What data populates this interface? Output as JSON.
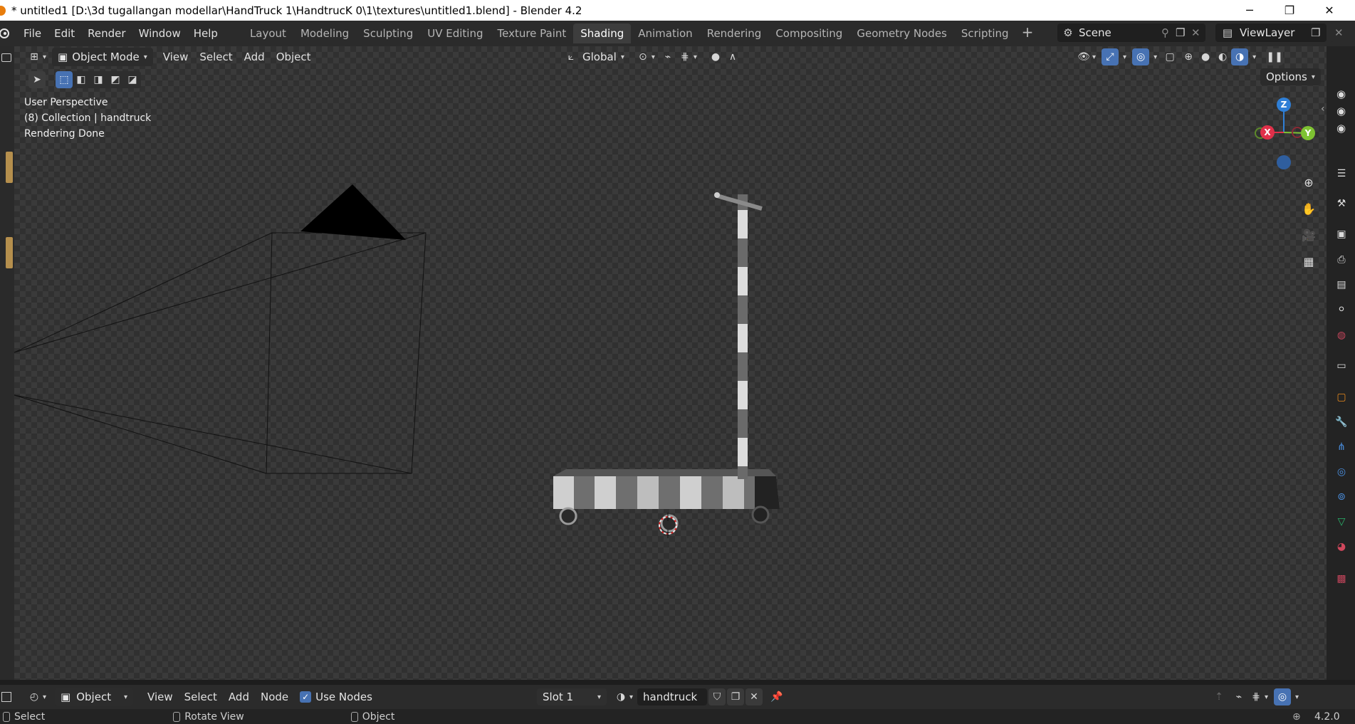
{
  "window": {
    "title": "* untitled1 [D:\\3d tugallangan modellar\\HandTruck 1\\HandtrucK 0\\1\\textures\\untitled1.blend] - Blender 4.2",
    "minimize": "─",
    "maximize": "❐",
    "close": "✕"
  },
  "menu": [
    "File",
    "Edit",
    "Render",
    "Window",
    "Help"
  ],
  "workspaces": [
    "Layout",
    "Modeling",
    "Sculpting",
    "UV Editing",
    "Texture Paint",
    "Shading",
    "Animation",
    "Rendering",
    "Compositing",
    "Geometry Nodes",
    "Scripting"
  ],
  "active_workspace": "Shading",
  "scene": {
    "label": "Scene",
    "view_layer": "ViewLayer"
  },
  "viewport_header": {
    "mode": "Object Mode",
    "menus": [
      "View",
      "Select",
      "Add",
      "Object"
    ],
    "transform_orientation": "Global",
    "options": "Options"
  },
  "viewport_overlay": {
    "perspective": "User Perspective",
    "collection": "(8) Collection | handtruck",
    "status": "Rendering Done"
  },
  "gizmo": {
    "z": "Z",
    "x": "X",
    "y": "Y"
  },
  "node_header": {
    "editor_type": "Object",
    "menus": [
      "View",
      "Select",
      "Add",
      "Node"
    ],
    "use_nodes": "Use Nodes",
    "slot": "Slot 1",
    "material": "handtruck"
  },
  "statusbar": {
    "select": "Select",
    "rotate": "Rotate View",
    "object": "Object",
    "version": "4.2.0"
  },
  "colors": {
    "accent": "#4772b3",
    "axis_x": "#e0304a",
    "axis_y": "#7ec232",
    "axis_z": "#2f7fd6"
  }
}
